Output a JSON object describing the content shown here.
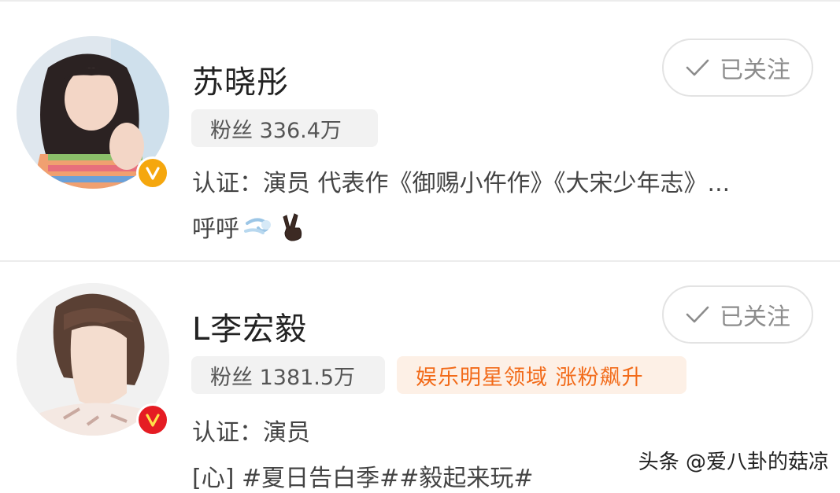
{
  "users": [
    {
      "name": "苏晓彤",
      "follow_label": "已关注",
      "fans_label": "粉丝 336.4万",
      "cert": "认证：演员 代表作《御赐小仵作》《大宋少年志》...",
      "bio": "呼呼",
      "badge_color": "#f5a70e"
    },
    {
      "name": "L李宏毅",
      "follow_label": "已关注",
      "fans_label": "粉丝 1381.5万",
      "hot_tag": "娱乐明星领域 涨粉飙升",
      "cert": "认证：演员",
      "bio": "[心] #夏日告白季##毅起来玩#",
      "badge_color": "#e51c23"
    }
  ],
  "watermark": "头条 @爱八卦的菇凉",
  "colors": {
    "hot_tag_text": "#f26b1a",
    "hot_tag_bg": "#fdf0e6",
    "button_text": "#8c8c8c"
  }
}
